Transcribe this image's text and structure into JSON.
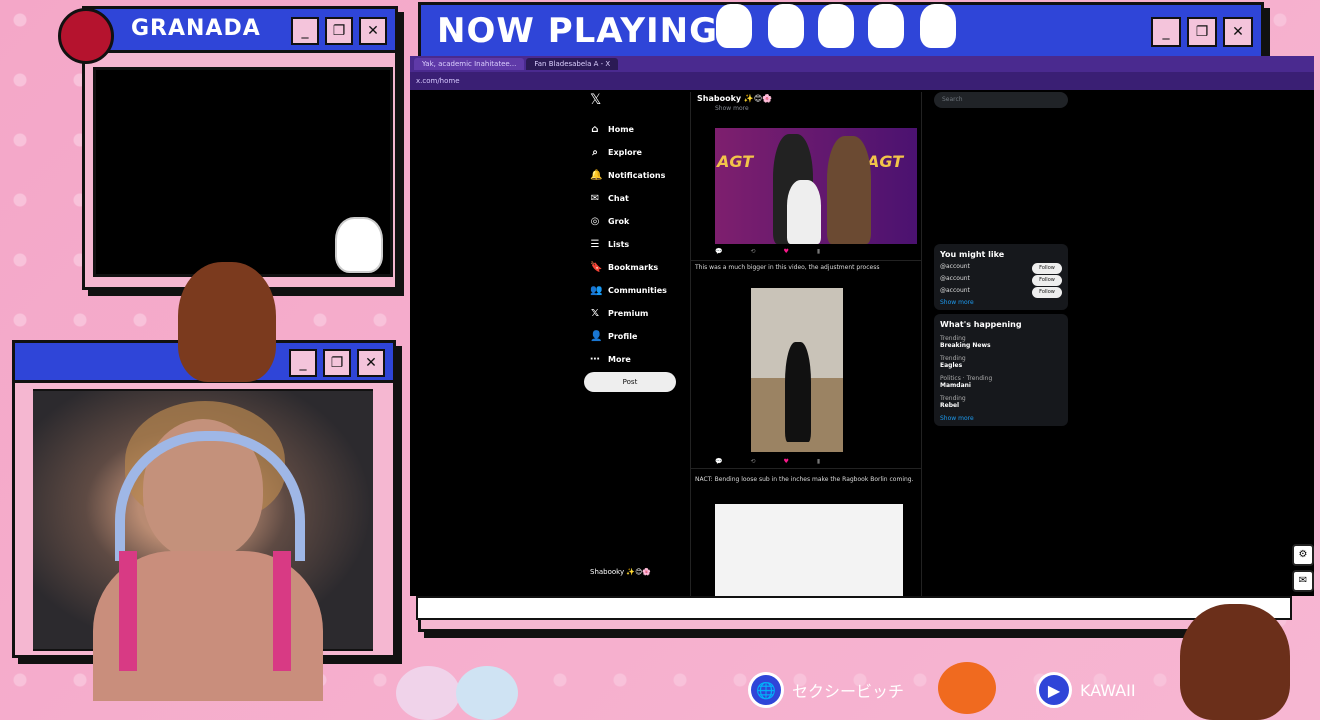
{
  "granada_window": {
    "title": "GRANADA"
  },
  "now_window": {
    "title": "NOW PLAYING"
  },
  "window_controls": {
    "minimize": "_",
    "maximize": "❐",
    "close": "✕"
  },
  "browser": {
    "tabs": [
      "Yak, academic Inahitatee...",
      "Fan Bladesabela A - X"
    ],
    "url": "x.com/home"
  },
  "x_nav": {
    "logo": "𝕏",
    "items": [
      {
        "icon": "⌂",
        "label": "Home"
      },
      {
        "icon": "⌕",
        "label": "Explore"
      },
      {
        "icon": "🔔",
        "label": "Notifications"
      },
      {
        "icon": "✉",
        "label": "Chat"
      },
      {
        "icon": "◎",
        "label": "Grok"
      },
      {
        "icon": "☰",
        "label": "Lists"
      },
      {
        "icon": "🔖",
        "label": "Bookmarks"
      },
      {
        "icon": "👥",
        "label": "Communities"
      },
      {
        "icon": "𝕏",
        "label": "Premium"
      },
      {
        "icon": "👤",
        "label": "Profile"
      },
      {
        "icon": "⋯",
        "label": "More"
      }
    ],
    "post_button": "Post",
    "account": "Shabooky ✨😊🌸"
  },
  "feed": {
    "header_name": "Shabooky ✨😊🌸",
    "header_sub": "Show more",
    "tweet2_text": "This was a much bigger in this video, the adjustment process",
    "tweet3_text": "NACT: Bending loose sub in the inches make the Ragbook Borlin coming."
  },
  "right_col": {
    "search_placeholder": "Search",
    "you_might_like": "You might like",
    "follow_label": "Follow",
    "whats_happening": "What's happening",
    "show_more": "Show more",
    "trends": [
      {
        "title": "Breaking News",
        "sub": "Trending"
      },
      {
        "title": "Eagles",
        "sub": "Trending"
      },
      {
        "title": "Mamdani",
        "sub": "Politics · Trending"
      },
      {
        "title": "Rebel",
        "sub": "Trending"
      }
    ]
  },
  "dock": {
    "item1_label": "セクシービッチ",
    "item2_label": "KAWAII"
  },
  "colors": {
    "titlebar": "#2f45d8",
    "window_bg": "#f5b7d1",
    "page_bg": "#f3a9c9"
  }
}
